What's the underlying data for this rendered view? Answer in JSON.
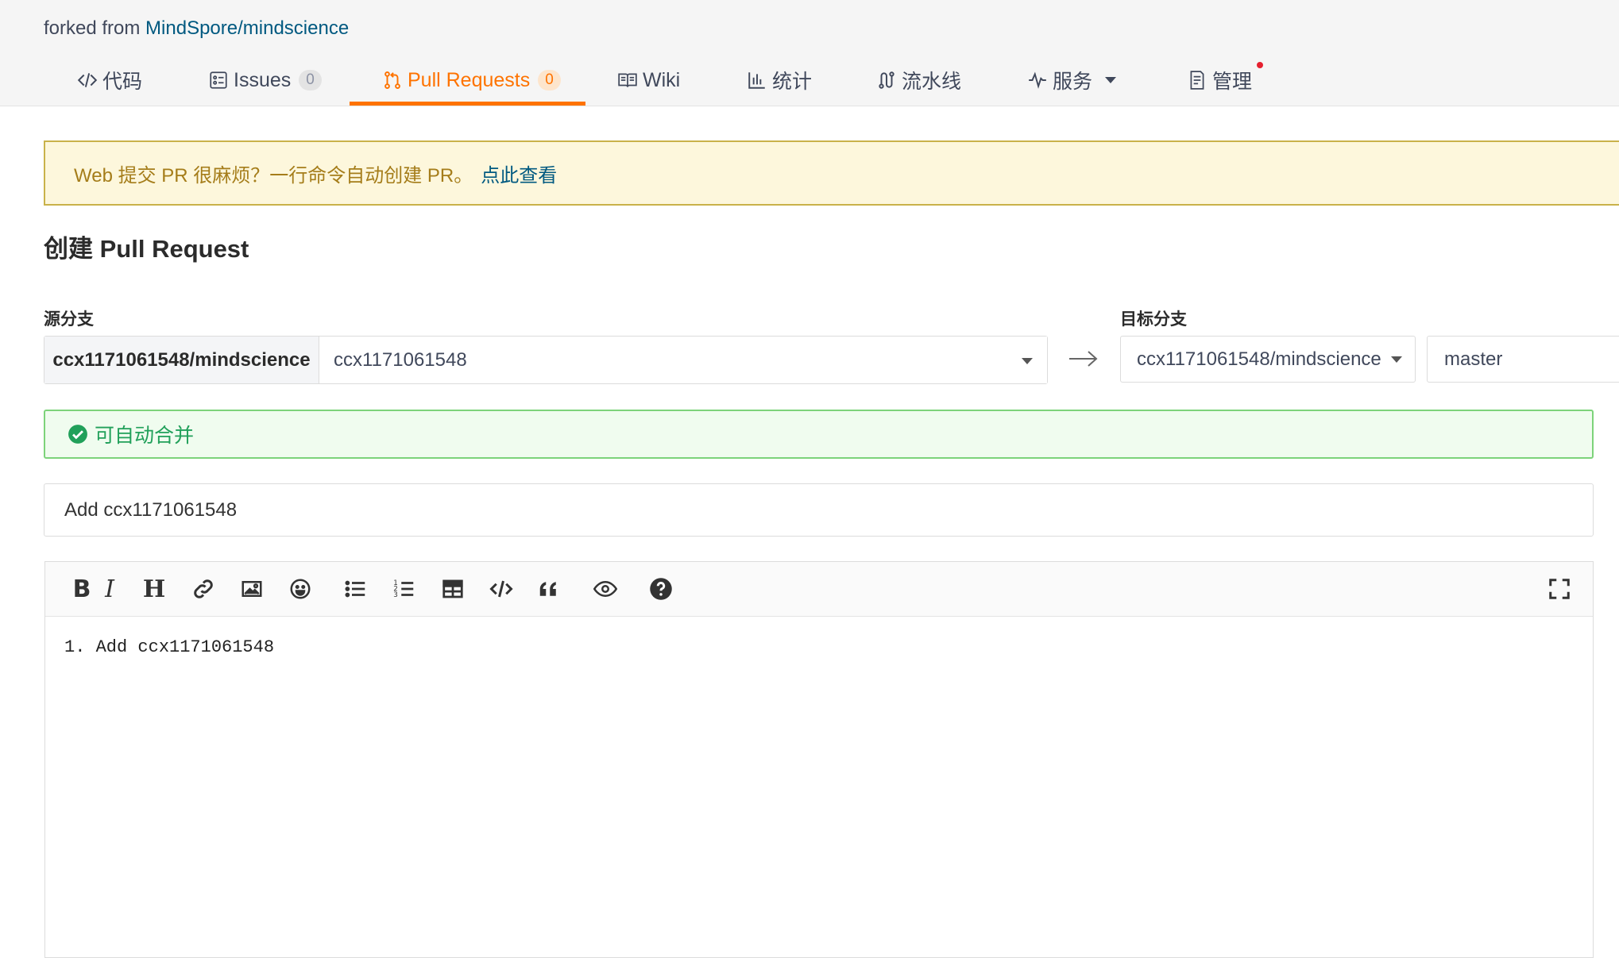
{
  "header": {
    "forked_prefix": "forked from",
    "forked_link": "MindSpore/mindscience",
    "tabs": [
      {
        "label": "代码",
        "icon": "code-icon"
      },
      {
        "label": "Issues",
        "count": "0",
        "icon": "issues-icon"
      },
      {
        "label": "Pull Requests",
        "count": "0",
        "icon": "pull-request-icon",
        "active": true
      },
      {
        "label": "Wiki",
        "icon": "book-icon"
      },
      {
        "label": "统计",
        "icon": "bar-chart-icon"
      },
      {
        "label": "流水线",
        "icon": "pipeline-icon"
      },
      {
        "label": "服务",
        "icon": "activity-icon",
        "has_dropdown": true
      },
      {
        "label": "管理",
        "icon": "settings-doc-icon",
        "notification": true
      }
    ],
    "active_color": "#fe7300"
  },
  "banner": {
    "text": "Web 提交 PR 很麻烦？一行命令自动创建 PR。",
    "link": "点此查看"
  },
  "page_title": "创建 Pull Request",
  "source": {
    "label": "源分支",
    "repo": "ccx1171061548/mindscience",
    "branch": "ccx1171061548"
  },
  "target": {
    "label": "目标分支",
    "repo": "ccx1171061548/mindscience",
    "branch": "master"
  },
  "merge_status": {
    "text": "可自动合并",
    "color": "#21a05a"
  },
  "pr_title": {
    "value": "Add ccx1171061548"
  },
  "editor": {
    "toolbar": [
      "bold",
      "italic",
      "heading",
      "link",
      "image",
      "emoji",
      "unordered-list",
      "ordered-list",
      "table",
      "code",
      "quote",
      "preview",
      "help",
      "fullscreen"
    ],
    "content": "1. Add ccx1171061548"
  }
}
